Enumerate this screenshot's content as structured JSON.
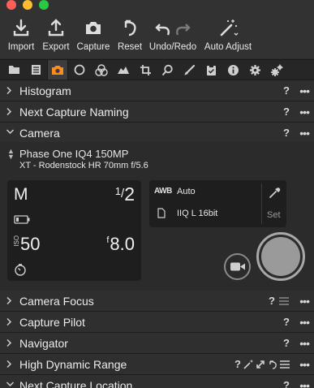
{
  "toolbar": {
    "items": [
      {
        "label": "Import",
        "icon": "import-icon"
      },
      {
        "label": "Export",
        "icon": "export-icon"
      },
      {
        "label": "Capture",
        "icon": "camera-icon"
      },
      {
        "label": "Reset",
        "icon": "reset-icon"
      },
      {
        "label": "Undo/Redo",
        "icon": "undo-redo-icon"
      },
      {
        "label": "Auto Adjust",
        "icon": "magic-wand-icon"
      }
    ]
  },
  "tool_tabs": [
    "folder-icon",
    "list-icon",
    "camera-icon",
    "circle-icon",
    "color-icon",
    "exposure-icon",
    "crop-icon",
    "loupe-icon",
    "brush-icon",
    "clipboard-icon",
    "info-icon",
    "gear-icon",
    "batch-gear-icon"
  ],
  "active_tab": "camera-icon",
  "sections": {
    "histogram": {
      "title": "Histogram",
      "help": "?",
      "more": "•••"
    },
    "next_capture_naming": {
      "title": "Next Capture Naming",
      "help": "?",
      "more": "•••"
    },
    "camera": {
      "title": "Camera",
      "help": "?",
      "more": "•••"
    },
    "camera_focus": {
      "title": "Camera Focus",
      "help": "?",
      "more": "•••"
    },
    "capture_pilot": {
      "title": "Capture Pilot",
      "help": "?",
      "more": "•••"
    },
    "navigator": {
      "title": "Navigator",
      "help": "?",
      "more": "•••"
    },
    "hdr": {
      "title": "High Dynamic Range",
      "help": "?",
      "more": "•••"
    },
    "next_capture_location": {
      "title": "Next Capture Location",
      "help": "?",
      "more": "•••"
    }
  },
  "camera": {
    "model": "Phase One IQ4 150MP",
    "lens": "XT - Rodenstock HR 70mm f/5.6",
    "mode": "M",
    "shutter_num": "1",
    "shutter_sep": "/",
    "shutter_den": "2",
    "iso_label": "ISO",
    "iso": "50",
    "fstop_prefix": "f",
    "fstop": "8.0",
    "wb_label": "AWB",
    "wb_value": "Auto",
    "format": "IIQ L 16bit",
    "set_label": "Set"
  },
  "colors": {
    "active_tab_icon": "#ff8c1a",
    "capture_button": "#9a9a9a"
  }
}
